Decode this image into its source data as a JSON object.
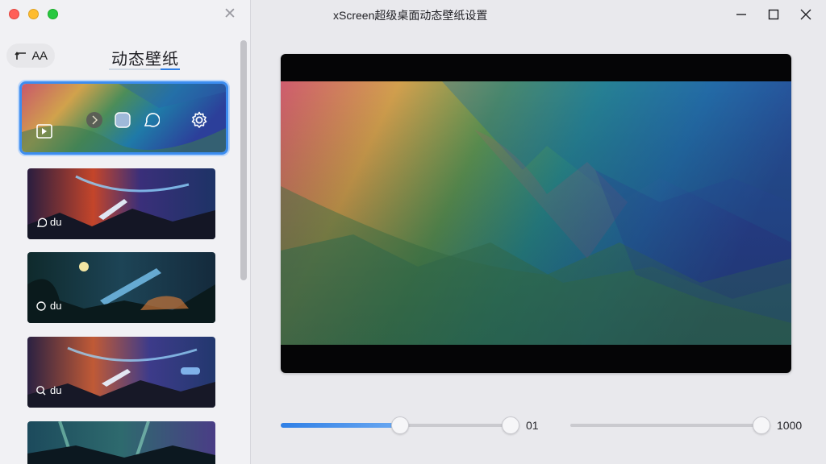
{
  "window": {
    "title": "xScreen超级桌面动态壁纸设置"
  },
  "sidebar": {
    "back_label": "AA",
    "title": "动态壁纸",
    "items": [
      {
        "badge": "du"
      },
      {
        "badge": "du"
      },
      {
        "badge": "du"
      }
    ]
  },
  "controls": {
    "slider_1": {
      "value": 0.52,
      "label": "01"
    },
    "slider_2": {
      "value": 1.0,
      "label": "1000"
    }
  },
  "colors": {
    "accent": "#2f7fe6"
  }
}
